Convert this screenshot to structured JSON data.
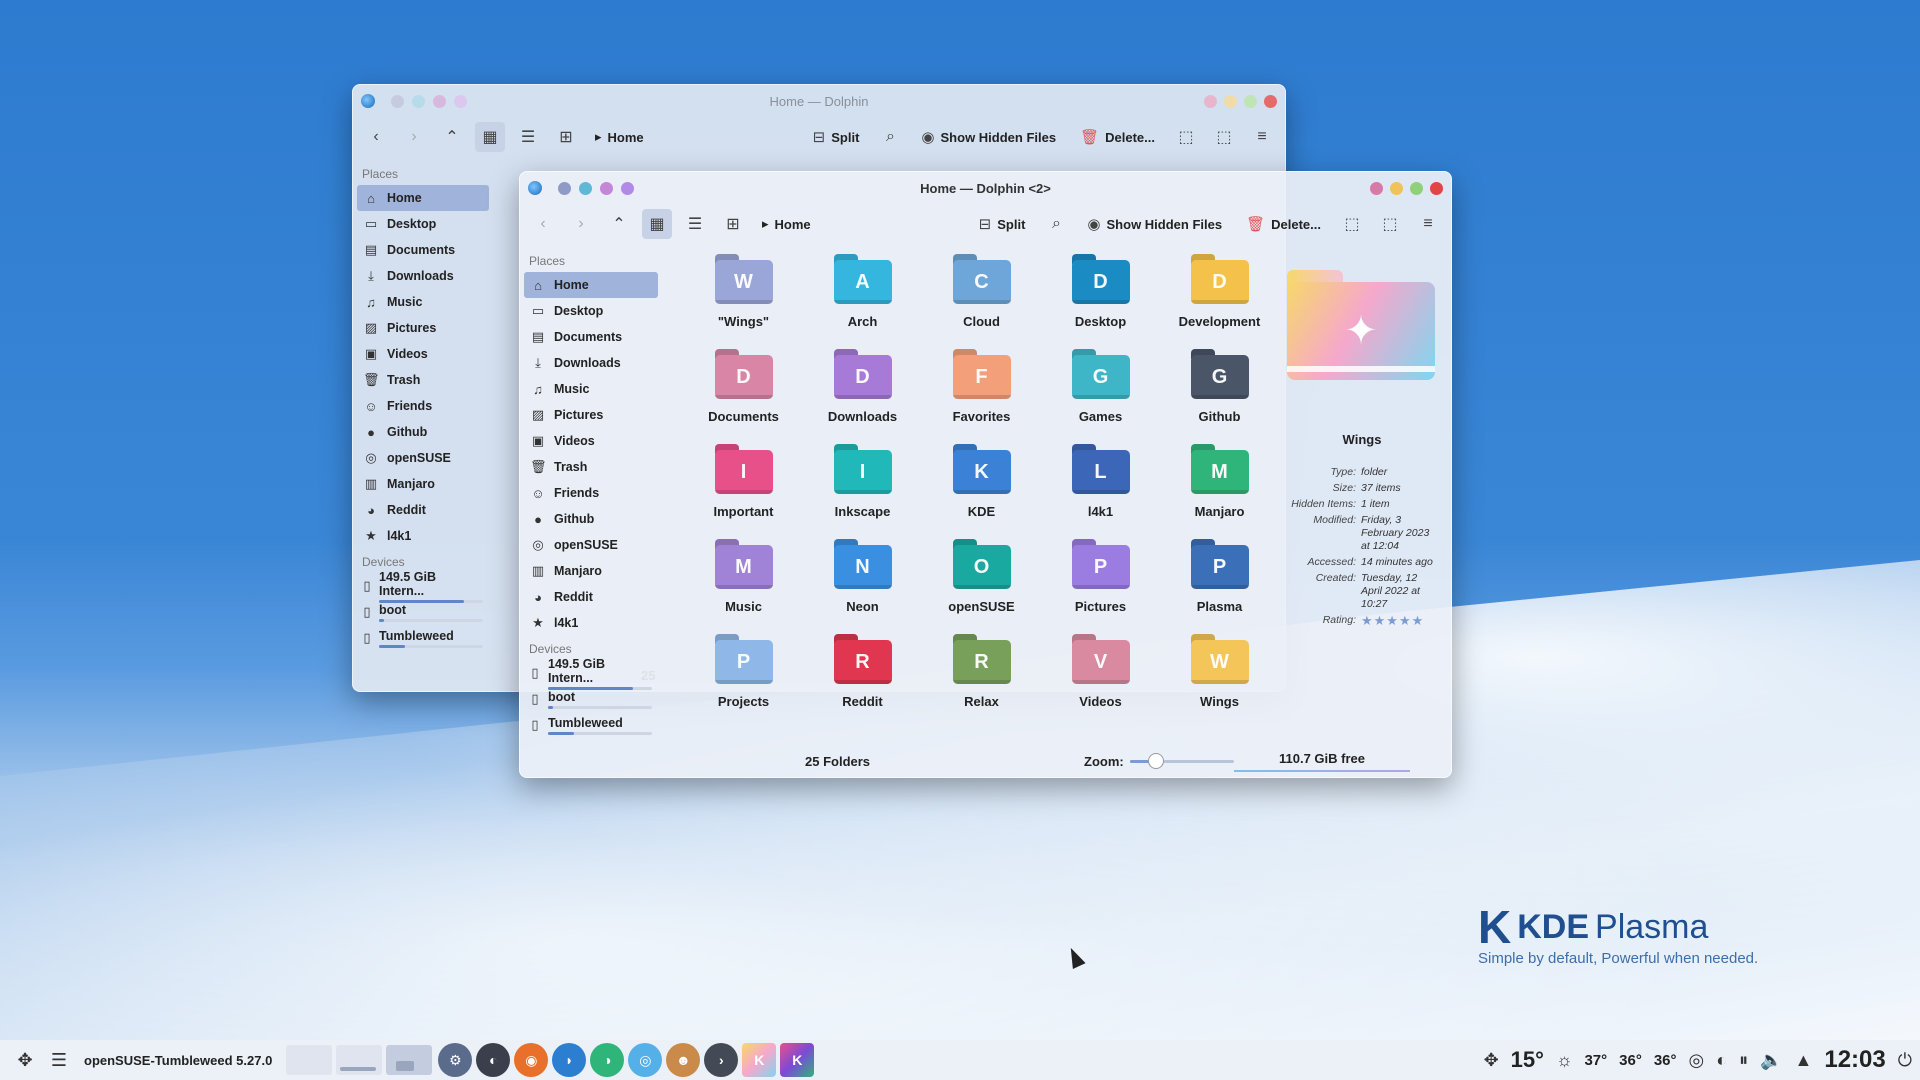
{
  "desktop": {
    "brand": "KDE",
    "brand_product": "Plasma",
    "tagline": "Simple by default, Powerful when  needed."
  },
  "back_window": {
    "title": "Home — Dolphin",
    "breadcrumb": "Home",
    "toolbar": {
      "split": "Split",
      "hidden": "Show Hidden Files",
      "delete": "Delete..."
    },
    "places_heading": "Places",
    "places": [
      "Home",
      "Desktop",
      "Documents",
      "Downloads",
      "Music",
      "Pictures",
      "Videos",
      "Trash",
      "Friends",
      "Github",
      "openSUSE",
      "Manjaro",
      "Reddit",
      "l4k1"
    ],
    "devices_heading": "Devices",
    "devices": [
      {
        "label": "149.5 GiB Intern...",
        "usage": 0.82
      },
      {
        "label": "boot",
        "usage": 0.05
      },
      {
        "label": "Tumbleweed",
        "usage": 0.25
      }
    ],
    "status_partial": "25"
  },
  "front_window": {
    "title": "Home — Dolphin <2>",
    "breadcrumb": "Home",
    "toolbar": {
      "split": "Split",
      "hidden": "Show Hidden Files",
      "delete": "Delete..."
    },
    "places_heading": "Places",
    "places": [
      "Home",
      "Desktop",
      "Documents",
      "Downloads",
      "Music",
      "Pictures",
      "Videos",
      "Trash",
      "Friends",
      "Github",
      "openSUSE",
      "Manjaro",
      "Reddit",
      "l4k1"
    ],
    "devices_heading": "Devices",
    "devices": [
      {
        "label": "149.5 GiB Intern...",
        "usage": 0.82
      },
      {
        "label": "boot",
        "usage": 0.05
      },
      {
        "label": "Tumbleweed",
        "usage": 0.25
      }
    ],
    "folders": [
      {
        "label": "\"Wings\"",
        "color": "#9aa6d8"
      },
      {
        "label": "Arch",
        "color": "#34b6df"
      },
      {
        "label": "Cloud",
        "color": "#6fa6d9"
      },
      {
        "label": "Desktop",
        "color": "#1b8bc4"
      },
      {
        "label": "Development",
        "color": "#f4c24a"
      },
      {
        "label": "Documents",
        "color": "#d985a6"
      },
      {
        "label": "Downloads",
        "color": "#a67ad6"
      },
      {
        "label": "Favorites",
        "color": "#f3a07a"
      },
      {
        "label": "Games",
        "color": "#3fb6c7"
      },
      {
        "label": "Github",
        "color": "#4a5568"
      },
      {
        "label": "Important",
        "color": "#e8508a"
      },
      {
        "label": "Inkscape",
        "color": "#20b8b8"
      },
      {
        "label": "KDE",
        "color": "#3b82d6"
      },
      {
        "label": "l4k1",
        "color": "#3c67b8"
      },
      {
        "label": "Manjaro",
        "color": "#2fb47a"
      },
      {
        "label": "Music",
        "color": "#a083d6"
      },
      {
        "label": "Neon",
        "color": "#3b8fe0"
      },
      {
        "label": "openSUSE",
        "color": "#19a9a0"
      },
      {
        "label": "Pictures",
        "color": "#9b7ce0"
      },
      {
        "label": "Plasma",
        "color": "#3b6fb8"
      },
      {
        "label": "Projects",
        "color": "#8fb8e8"
      },
      {
        "label": "Reddit",
        "color": "#e0364f"
      },
      {
        "label": "Relax",
        "color": "#78a05a"
      },
      {
        "label": "Videos",
        "color": "#d98aa0"
      },
      {
        "label": "Wings",
        "color": "#f4c65a"
      }
    ],
    "info": {
      "name": "Wings",
      "type_k": "Type:",
      "type_v": "folder",
      "size_k": "Size:",
      "size_v": "37 items",
      "hidden_k": "Hidden Items:",
      "hidden_v": "1 item",
      "modified_k": "Modified:",
      "modified_v": "Friday, 3 February 2023 at 12:04",
      "accessed_k": "Accessed:",
      "accessed_v": "14 minutes ago",
      "created_k": "Created:",
      "created_v": "Tuesday, 12 April 2022 at 10:27",
      "rating_k": "Rating:",
      "rating_v": "★★★★★"
    },
    "status": {
      "count": "25 Folders",
      "zoom_label": "Zoom:",
      "zoom_level": 0.25,
      "free": "110.7 GiB free"
    }
  },
  "taskbar": {
    "task_title": "openSUSE-Tumbleweed 5.27.0",
    "temps": [
      "15°",
      "37°",
      "36°",
      "36°"
    ],
    "clock": "12:03"
  }
}
